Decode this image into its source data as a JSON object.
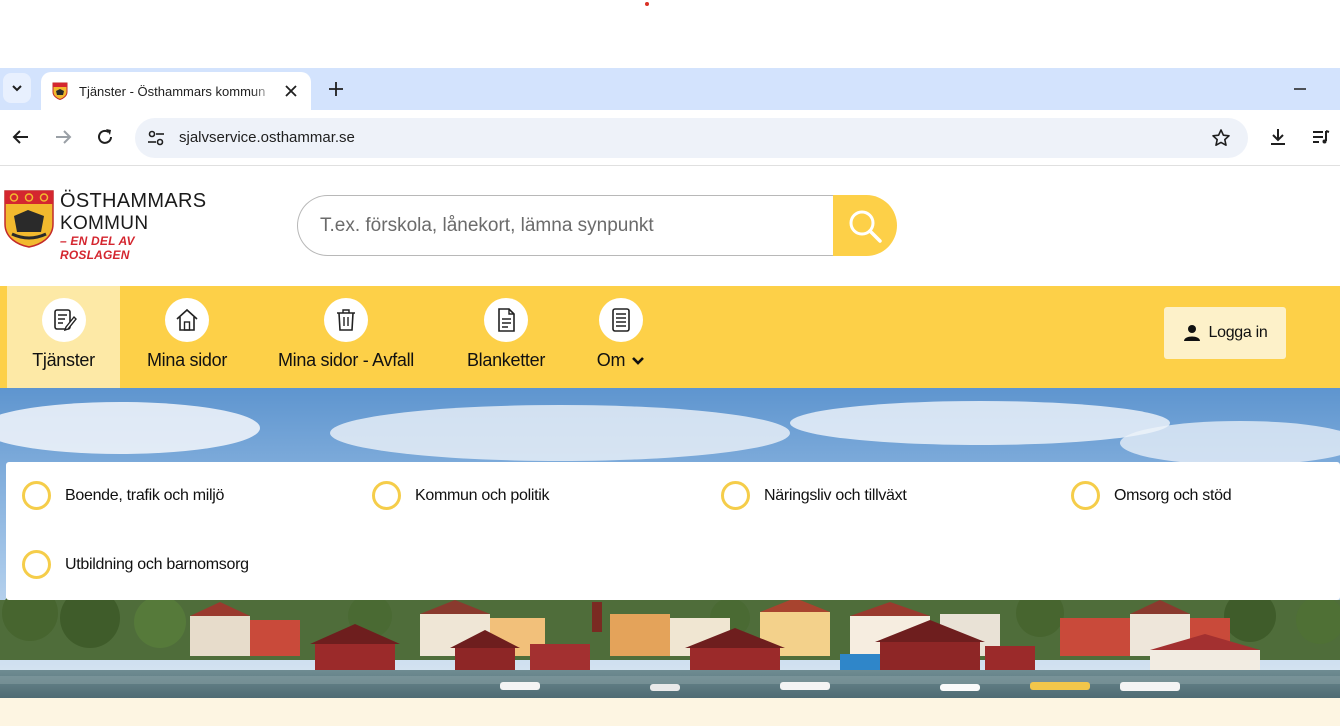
{
  "browser": {
    "tab_title": "Tjänster - Östhammars kommun",
    "url": "sjalvservice.osthammar.se",
    "icons": [
      "tab-list-icon",
      "close-icon",
      "plus-icon",
      "minimize-icon",
      "back-arrow-icon",
      "forward-arrow-icon",
      "reload-icon",
      "site-settings-icon",
      "star-icon",
      "download-icon",
      "media-queue-icon"
    ]
  },
  "site": {
    "logo": {
      "line1": "ÖSTHAMMARS",
      "line2": "KOMMUN",
      "line3": "– EN DEL AV ROSLAGEN"
    },
    "search": {
      "placeholder": "T.ex. förskola, lånekort, lämna synpunkt"
    },
    "nav": {
      "items": [
        {
          "label": "Tjänster",
          "icon": "edit-document-icon",
          "active": true
        },
        {
          "label": "Mina sidor",
          "icon": "home-icon"
        },
        {
          "label": "Mina sidor - Avfall",
          "icon": "trash-bin-icon"
        },
        {
          "label": "Blanketter",
          "icon": "document-icon"
        },
        {
          "label": "Om",
          "icon": "list-document-icon",
          "dropdown": true
        }
      ],
      "login_label": "Logga in"
    },
    "categories": [
      "Boende, trafik och miljö",
      "Kommun och politik",
      "Näringsliv och tillväxt",
      "Omsorg och stöd",
      "Utbildning och barnomsorg"
    ],
    "colors": {
      "brand_yellow": "#fdd048",
      "active_nav": "#fde9a6",
      "ring": "#f5cd4a",
      "logo_red": "#d4262f"
    }
  }
}
